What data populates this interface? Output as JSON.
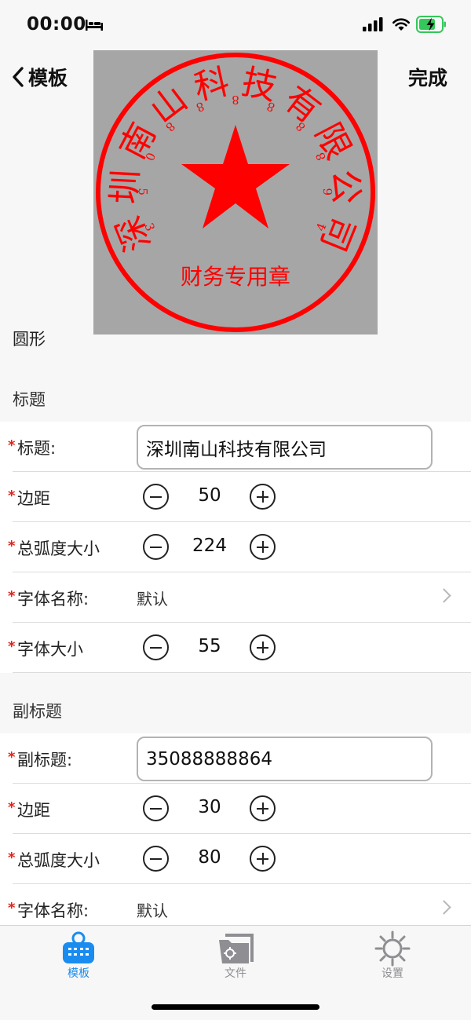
{
  "status_bar": {
    "time": "00:00"
  },
  "nav": {
    "back_label": "模板",
    "done_label": "完成"
  },
  "seal": {
    "company_name": "深圳南山科技有限公司",
    "center_text": "财务专用章",
    "code_text": "35088888864",
    "color": "#ff0000",
    "background": "#a6a6a6"
  },
  "shape_label": "圆形",
  "title_section": {
    "header": "标题",
    "title_label": "标题:",
    "title_value": "深圳南山科技有限公司",
    "margin_label": "边距",
    "margin_value": "50",
    "arc_label": "总弧度大小",
    "arc_value": "224",
    "font_name_label": "字体名称:",
    "font_name_value": "默认",
    "font_size_label": "字体大小",
    "font_size_value": "55"
  },
  "subtitle_section": {
    "header": "副标题",
    "subtitle_label": "副标题:",
    "subtitle_value": "35088888864",
    "margin_label": "边距",
    "margin_value": "30",
    "arc_label": "总弧度大小",
    "arc_value": "80",
    "font_name_label": "字体名称:",
    "font_name_value": "默认"
  },
  "required_mark": "*",
  "tabs": [
    {
      "label": "模板",
      "icon": "basket-icon",
      "active": true
    },
    {
      "label": "文件",
      "icon": "folder-gear-icon",
      "active": false
    },
    {
      "label": "设置",
      "icon": "gear-icon",
      "active": false
    }
  ],
  "colors": {
    "accent": "#1a8cf0",
    "tab_inactive": "#8e8e93",
    "required": "#e0231a",
    "battery_green": "#34c759"
  }
}
